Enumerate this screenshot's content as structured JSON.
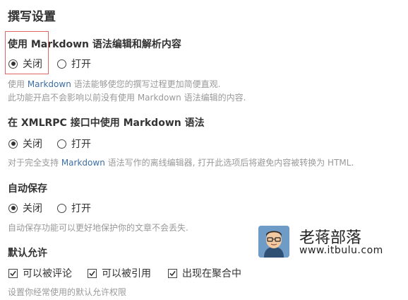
{
  "page": {
    "title": "撰写设置"
  },
  "sections": [
    {
      "title": "使用 Markdown 语法编辑和解析内容",
      "options": [
        "关闭",
        "打开"
      ],
      "selected": "关闭",
      "desc": {
        "line1_pre": "使用 ",
        "line1_link": "Markdown",
        "line1_post": " 语法能够使您的撰写过程更加简便直观.",
        "line2": "此功能开启不会影响以前没有使用 Markdown 语法编辑的内容."
      }
    },
    {
      "title": "在 XMLRPC 接口中使用 Markdown 语法",
      "options": [
        "关闭",
        "打开"
      ],
      "selected": "关闭",
      "desc": {
        "line1_pre": "对于完全支持 ",
        "line1_link": "Markdown",
        "line1_post": " 语法写作的离线编辑器, 打开此选项后将避免内容被转换为 HTML."
      }
    },
    {
      "title": "自动保存",
      "options": [
        "关闭",
        "打开"
      ],
      "selected": "关闭",
      "desc": {
        "line1": "自动保存功能可以更好地保护你的文章不会丢失."
      }
    },
    {
      "title": "默认允许",
      "checkboxes": [
        {
          "label": "可以被评论",
          "checked": true
        },
        {
          "label": "可以被引用",
          "checked": true
        },
        {
          "label": "出现在聚合中",
          "checked": true
        }
      ],
      "desc": {
        "line1": "设置你经常使用的默认允许权限"
      }
    }
  ],
  "watermark": {
    "name": "老蒋部落",
    "url": "www.itbulu.com"
  },
  "colors": {
    "link": "#3c6ea5",
    "highlight_border": "#e06666",
    "desc_text": "#999999"
  }
}
